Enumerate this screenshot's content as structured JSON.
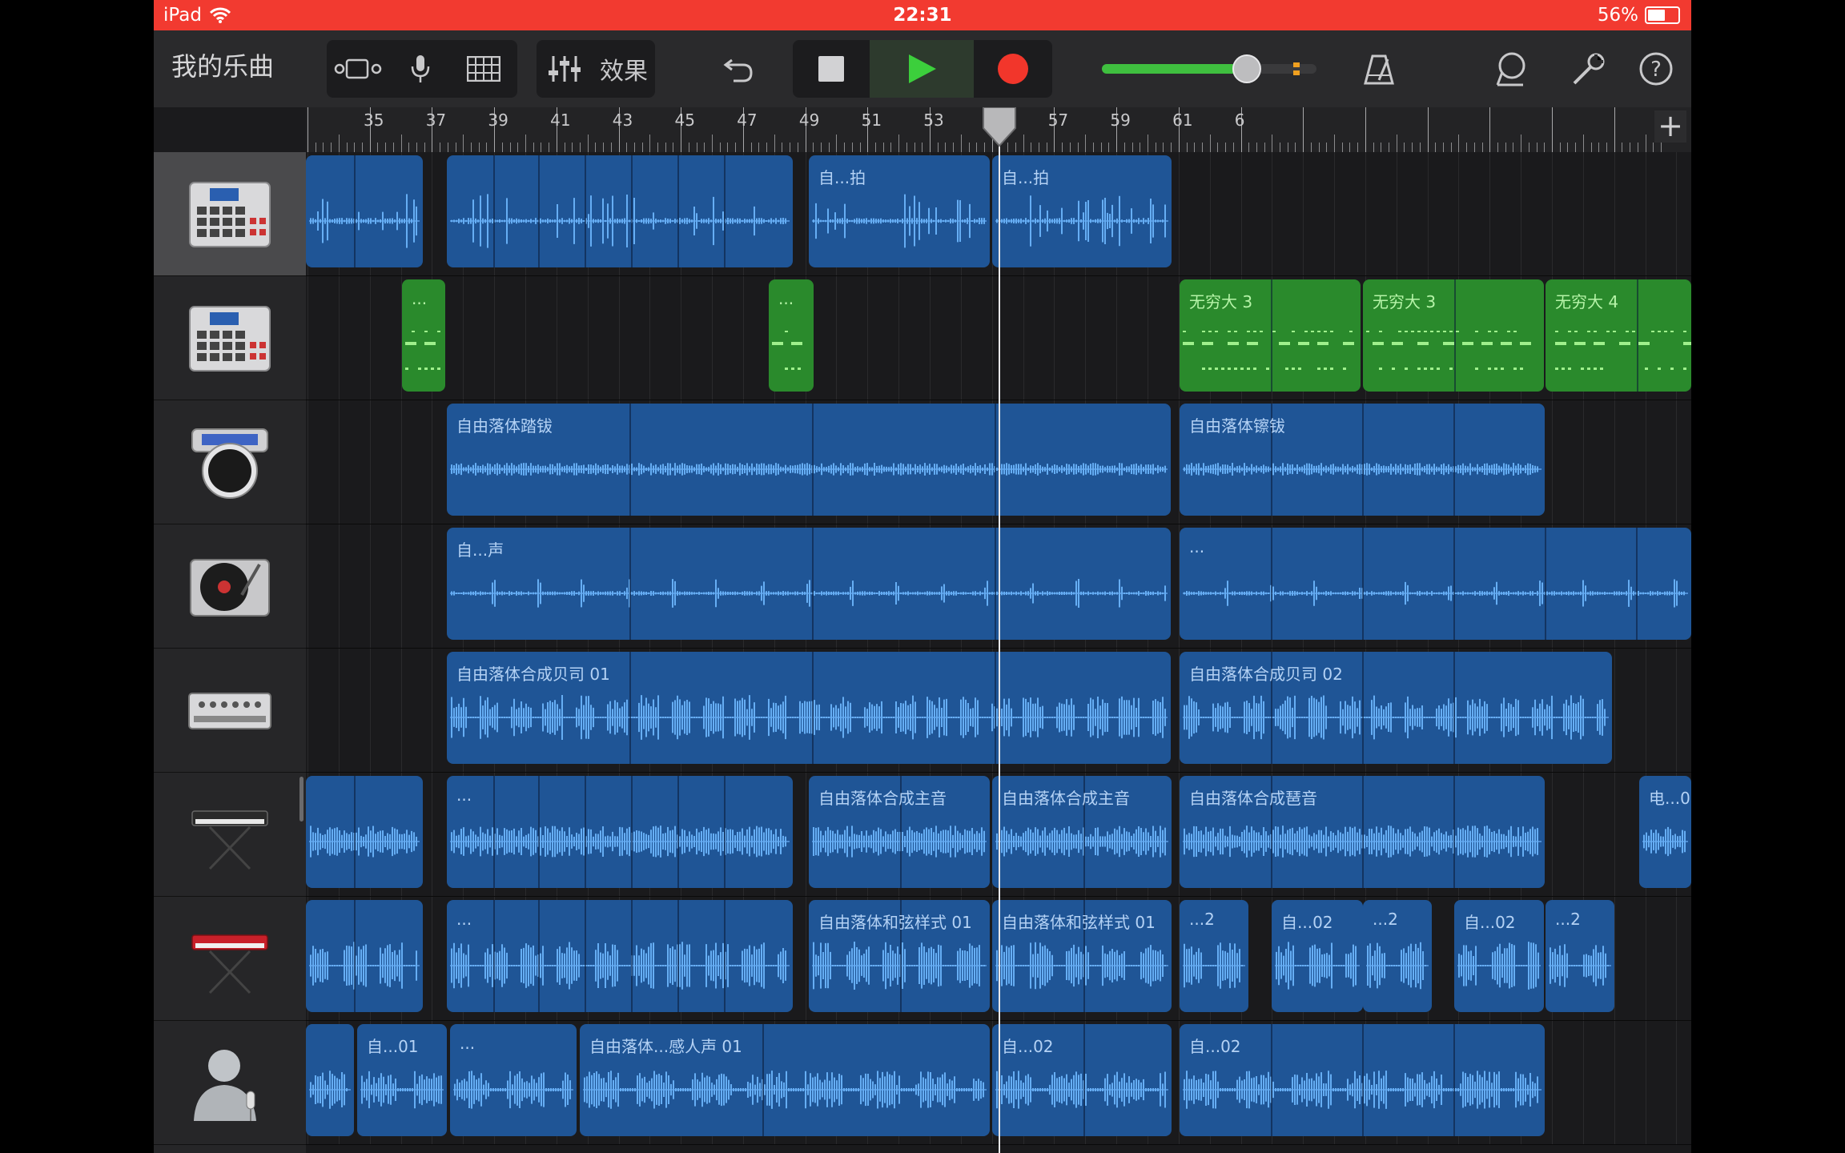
{
  "status_bar": {
    "device": "iPad",
    "time": "22:31",
    "battery": "56%"
  },
  "toolbar": {
    "song_title": "我的乐曲",
    "effects_label": "效果",
    "icons": [
      "browser-icon",
      "microphone-icon",
      "grid-icon",
      "mixer-icon",
      "undo-icon",
      "stop-icon",
      "play-icon",
      "record-icon",
      "metronome-icon",
      "loop-icon",
      "wrench-icon",
      "help-icon"
    ],
    "colors": {
      "play": "#3ccf3c",
      "record": "#f2362b",
      "volume": "#3fbf3f"
    },
    "master_volume": 0.78
  },
  "ruler": {
    "bars": [
      "35",
      "37",
      "39",
      "41",
      "43",
      "45",
      "47",
      "49",
      "51",
      "53",
      "55",
      "57",
      "59",
      "61",
      "6"
    ],
    "add_label": "+"
  },
  "tracks": [
    {
      "instrument": "drum-machine",
      "selected": true
    },
    {
      "instrument": "drum-machine",
      "selected": false
    },
    {
      "instrument": "drum-synth",
      "selected": false
    },
    {
      "instrument": "turntable",
      "selected": false
    },
    {
      "instrument": "bass-synth",
      "selected": false
    },
    {
      "instrument": "keyboard",
      "selected": false
    },
    {
      "instrument": "red-keyboard",
      "selected": false
    },
    {
      "instrument": "vocalist",
      "selected": false
    }
  ],
  "regions": [
    [
      {
        "label": ""
      },
      {
        "label": ""
      },
      {
        "label": "自...拍"
      },
      {
        "label": "自...拍"
      }
    ],
    [
      {
        "label": "..."
      },
      {
        "label": "..."
      },
      {
        "label": "无穷大 3"
      },
      {
        "label": "无穷大 3"
      },
      {
        "label": "无穷大 4"
      }
    ],
    [
      {
        "label": "自由落体踏钹"
      },
      {
        "label": "自由落体镲钹"
      }
    ],
    [
      {
        "label": "自...声"
      },
      {
        "label": "..."
      }
    ],
    [
      {
        "label": "自由落体合成贝司 01"
      },
      {
        "label": "自由落体合成贝司 02"
      }
    ],
    [
      {
        "label": ""
      },
      {
        "label": "..."
      },
      {
        "label": "自由落体合成主音"
      },
      {
        "label": "自由落体合成主音"
      },
      {
        "label": "自由落体合成琶音"
      },
      {
        "label": "电...0"
      }
    ],
    [
      {
        "label": ""
      },
      {
        "label": "..."
      },
      {
        "label": "自由落体和弦样式 01"
      },
      {
        "label": "自由落体和弦样式 01"
      },
      {
        "label": "...2"
      },
      {
        "label": "自...02"
      },
      {
        "label": "...2"
      },
      {
        "label": "自...02"
      },
      {
        "label": "...2"
      }
    ],
    [
      {
        "label": ""
      },
      {
        "label": "自...01"
      },
      {
        "label": "..."
      },
      {
        "label": "自由落体...感人声 01"
      },
      {
        "label": "自...02"
      },
      {
        "label": "自...02"
      }
    ]
  ]
}
